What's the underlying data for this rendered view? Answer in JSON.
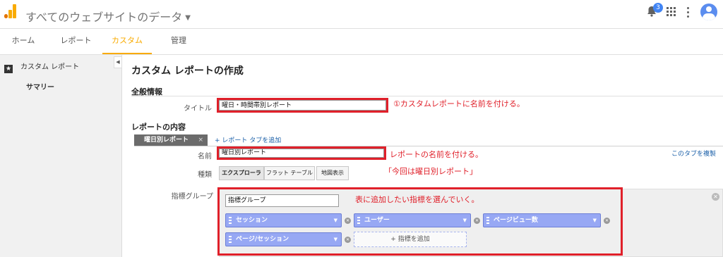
{
  "header": {
    "app_title": "すべてのウェブサイトのデータ",
    "notification_count": "3"
  },
  "nav": {
    "tabs": [
      "ホーム",
      "レポート",
      "カスタム",
      "管理"
    ],
    "active_tab": "カスタム"
  },
  "sidebar": {
    "item_label": "カスタム レポート",
    "sub_item_label": "サマリー"
  },
  "content": {
    "page_title": "カスタム レポートの作成",
    "general_section": "全般情報",
    "title_label": "タイトル",
    "title_value": "曜日・時間帯別レポート",
    "title_annotation": "①カスタムレポートに名前を付ける。",
    "report_content_section": "レポートの内容",
    "report_tab_name": "曜日別レポート",
    "report_tab_close": "×",
    "add_report_tab": "+ レポート タブを追加",
    "name_label": "名前",
    "name_value": "曜日別レポート",
    "name_annotation": "レポートの名前を付ける。",
    "copy_tab": "このタブを複製",
    "type_label": "種類",
    "type_options": [
      "エクスプローラ",
      "フラット テーブル",
      "地図表示"
    ],
    "type_annotation": "「今回は曜日別レポート」",
    "metric_group_label": "指標グループ",
    "metric_group_value": "指標グループ",
    "metric_annotation": "表に追加したい指標を選んでいく。",
    "metrics": [
      "セッション",
      "ユーザー",
      "ページビュー数",
      "ページ/セッション"
    ],
    "add_metric": "+ 指標を追加"
  },
  "colors": {
    "accent": "#f9ab00",
    "annotation_red": "#e0202a",
    "metric_chip": "#97a8f4",
    "link": "#1a5fa8"
  },
  "icons": [
    "analytics-logo-icon",
    "bell-icon",
    "apps-grid-icon",
    "more-vert-icon",
    "account-avatar-icon",
    "star-icon",
    "collapse-left-icon",
    "close-icon",
    "drag-grip-icon",
    "dropdown-arrow-icon"
  ]
}
